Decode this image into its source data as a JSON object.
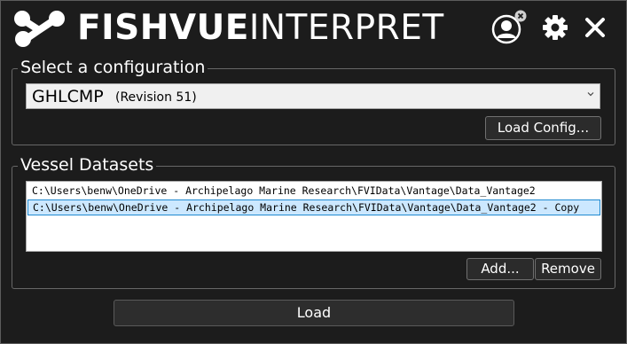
{
  "header": {
    "brand_bold": "FISHVUE",
    "brand_light": "INTERPRET",
    "icons": [
      "fishvue-logo-icon",
      "user-account-icon",
      "gear-icon",
      "close-icon"
    ]
  },
  "config": {
    "title": "Select a configuration",
    "selected_name": "GHLCMP",
    "selected_revision": "(Revision 51)",
    "load_config_label": "Load Config..."
  },
  "vessel": {
    "title": "Vessel Datasets",
    "items": [
      "C:\\Users\\benw\\OneDrive - Archipelago Marine Research\\FVIData\\Vantage\\Data_Vantage2",
      "C:\\Users\\benw\\OneDrive - Archipelago Marine Research\\FVIData\\Vantage\\Data_Vantage2 - Copy"
    ],
    "selected_index": 1,
    "add_label": "Add...",
    "remove_label": "Remove"
  },
  "footer": {
    "load_label": "Load"
  },
  "colors": {
    "background": "#1c1c1c",
    "selection": "#cce8ff",
    "selection_border": "#1f8ad1"
  }
}
